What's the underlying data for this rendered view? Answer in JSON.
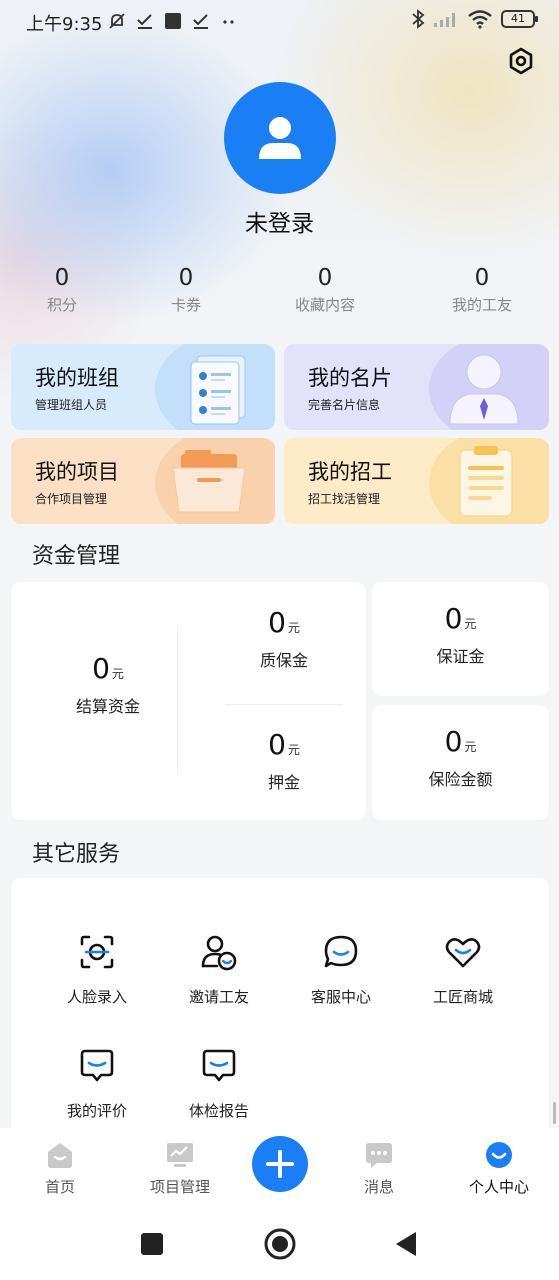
{
  "status_bar": {
    "time": "上午9:35",
    "battery": "41"
  },
  "profile": {
    "username": "未登录"
  },
  "stats": [
    {
      "value": "0",
      "label": "积分"
    },
    {
      "value": "0",
      "label": "卡券"
    },
    {
      "value": "0",
      "label": "收藏内容"
    },
    {
      "value": "0",
      "label": "我的工友"
    }
  ],
  "cards": [
    {
      "title": "我的班组",
      "subtitle": "管理班组人员"
    },
    {
      "title": "我的名片",
      "subtitle": "完善名片信息"
    },
    {
      "title": "我的项目",
      "subtitle": "合作项目管理"
    },
    {
      "title": "我的招工",
      "subtitle": "招工找活管理"
    }
  ],
  "funds": {
    "section_title": "资金管理",
    "unit": "元",
    "settlement": {
      "value": "0",
      "label": "结算资金"
    },
    "warranty": {
      "value": "0",
      "label": "质保金"
    },
    "deposit": {
      "value": "0",
      "label": "押金"
    },
    "guarantee": {
      "value": "0",
      "label": "保证金"
    },
    "insurance": {
      "value": "0",
      "label": "保险金额"
    }
  },
  "services": {
    "section_title": "其它服务",
    "items": [
      {
        "label": "人脸录入",
        "icon": "face-scan-icon"
      },
      {
        "label": "邀请工友",
        "icon": "invite-user-icon"
      },
      {
        "label": "客服中心",
        "icon": "chat-bubble-icon"
      },
      {
        "label": "工匠商城",
        "icon": "heart-icon"
      },
      {
        "label": "我的评价",
        "icon": "review-icon"
      },
      {
        "label": "体检报告",
        "icon": "report-icon"
      }
    ]
  },
  "tabbar": {
    "items": [
      {
        "label": "首页",
        "icon": "home-icon"
      },
      {
        "label": "项目管理",
        "icon": "project-icon"
      },
      {
        "label": "消息",
        "icon": "message-icon"
      },
      {
        "label": "个人中心",
        "icon": "profile-icon"
      }
    ],
    "active_index": 3,
    "accent": "#1a7ff5"
  },
  "colors": {
    "accent": "#1a7ff5",
    "card_team": "#d8ebfd",
    "card_namecard": "#e4e2fb",
    "card_project": "#fbe0c6",
    "card_recruit": "#fcebc6"
  }
}
